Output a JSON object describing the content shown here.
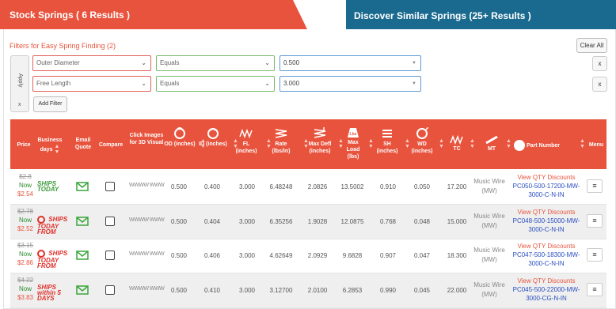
{
  "tabs": {
    "stock": "Stock Springs ( 6 Results )",
    "similar": "Discover Similar Springs (25+ Results )"
  },
  "filters": {
    "title": "Filters for Easy Spring Finding (2)",
    "clear_all": "Clear All",
    "side_label": "Apply",
    "side_x": "x",
    "add_filter": "Add Filter",
    "rows": [
      {
        "field": "Outer Diameter",
        "operator": "Equals",
        "value": "0.500",
        "remove": "x"
      },
      {
        "field": "Free Length",
        "operator": "Equals",
        "value": "3.000",
        "remove": "x"
      }
    ]
  },
  "table": {
    "headers": {
      "price": "Price",
      "business": "Business days",
      "email": "Email Quote",
      "compare": "Compare",
      "images": "Click Images for 3D Visual",
      "od": "OD (inches)",
      "id": "ID (inches)",
      "fl": "FL (inches)",
      "rate": "Rate (lbs/in)",
      "maxdefl": "Max Defl (inches)",
      "maxload": "Max Load (lbs)",
      "sh": "SH (inches)",
      "wd": "WD (inches)",
      "tc": "TC",
      "mt": "MT",
      "partnumber": "Part Number",
      "menu": "Menu",
      "load_icon_text": "Lbs"
    },
    "rows": [
      {
        "old": "$2.8",
        "now": "Now",
        "new": "$2.54",
        "ship": "SHIPS TODAY",
        "ship_style": "green",
        "visual": "WWWW  WWW",
        "od": "0.500",
        "id": "0.400",
        "fl": "3.000",
        "rate": "6.48248",
        "maxdefl": "2.0826",
        "maxload": "13.5002",
        "sh": "0.910",
        "wd": "0.050",
        "tc": "17.200",
        "mt": "Music Wire (MW)",
        "qty": "View QTY Discounts",
        "pn": "PC050-500-17200-MW-3000-C-N-IN",
        "menu": "≡"
      },
      {
        "old": "$2.78",
        "now": "Now",
        "new": "$2.52",
        "ship": "SHIPS TODAY FROM",
        "ship_style": "red",
        "visual": "WWWW  WWW",
        "od": "0.500",
        "id": "0.404",
        "fl": "3.000",
        "rate": "6.35256",
        "maxdefl": "1.9028",
        "maxload": "12.0875",
        "sh": "0.768",
        "wd": "0.048",
        "tc": "15.000",
        "mt": "Music Wire (MW)",
        "qty": "View QTY Discounts",
        "pn": "PC048-500-15000-MW-3000-C-N-IN",
        "menu": "≡"
      },
      {
        "old": "$3.15",
        "now": "Now",
        "new": "$2.86",
        "ship": "SHIPS TODAY FROM",
        "ship_style": "red",
        "visual": "WWWW  WWW",
        "od": "0.500",
        "id": "0.406",
        "fl": "3.000",
        "rate": "4.62649",
        "maxdefl": "2.0929",
        "maxload": "9.6828",
        "sh": "0.907",
        "wd": "0.047",
        "tc": "18.300",
        "mt": "Music Wire (MW)",
        "qty": "View QTY Discounts",
        "pn": "PC047-500-18300-MW-3000-C-N-IN",
        "menu": "≡"
      },
      {
        "old": "$4.22",
        "now": "Now",
        "new": "$3.83",
        "ship": "SHIPS within 5 DAYS",
        "ship_style": "red5",
        "visual": "WWWW  WWW",
        "od": "0.500",
        "id": "0.410",
        "fl": "3.000",
        "rate": "3.12700",
        "maxdefl": "2.0100",
        "maxload": "6.2853",
        "sh": "0.990",
        "wd": "0.045",
        "tc": "22.000",
        "mt": "Music Wire (MW)",
        "qty": "View QTY Discounts",
        "pn": "PC045-500-22000-MW-3000-CG-N-IN",
        "menu": "≡"
      }
    ]
  },
  "colors": {
    "accent": "#e8533d",
    "tab_blue": "#1a6a8f",
    "link": "#2b4ec0",
    "now_green": "#2e8b2e",
    "email_green": "#3aa53a"
  }
}
